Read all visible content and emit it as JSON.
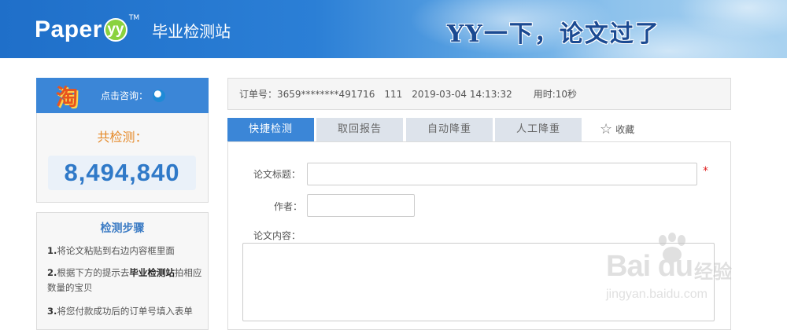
{
  "header": {
    "logo_word": "Paper",
    "logo_mark": "yy",
    "logo_tm": "TM",
    "site_name": "毕业检测站",
    "slogan": "YY一下，论文过了"
  },
  "sidebar": {
    "taobao_icon": "淘",
    "consult_label": "点击咨询：",
    "count_title": "共检测：",
    "count_value": "8,494,840",
    "steps_title": "检测步骤",
    "steps": [
      {
        "num": "1.",
        "text": "将论文粘贴到右边内容框里面"
      },
      {
        "num": "2.",
        "text_a": "根据下方的提示去",
        "text_hl": "毕业检测站",
        "text_b": "拍相应数量的宝贝"
      },
      {
        "num": "3.",
        "text": "将您付款成功后的订单号填入表单"
      }
    ]
  },
  "order": {
    "label": "订单号：",
    "number": "3659********491716",
    "code": "111",
    "datetime": "2019-03-04 14:13:32",
    "duration_label": "用时:",
    "duration": "10秒"
  },
  "tabs": [
    {
      "label": "快捷检测",
      "active": true
    },
    {
      "label": "取回报告",
      "active": false
    },
    {
      "label": "自动降重",
      "active": false
    },
    {
      "label": "人工降重",
      "active": false
    }
  ],
  "favorite": {
    "icon": "star-outline-icon",
    "label": "收藏"
  },
  "form": {
    "title_label": "论文标题：",
    "title_value": "",
    "required_mark": "*",
    "author_label": "作者：",
    "author_value": "",
    "content_label": "论文内容：",
    "content_value": ""
  },
  "watermark": {
    "brand": "Bai du",
    "cn": "经验",
    "url": "jingyan.baidu.com"
  },
  "colors": {
    "accent": "#3b86d7",
    "count_color": "#2f79c8",
    "count_title_color": "#e58a2a",
    "required": "#e02020"
  }
}
